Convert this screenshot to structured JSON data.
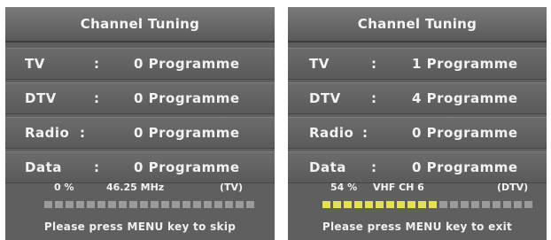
{
  "left": {
    "title": "Channel Tuning",
    "rows": [
      {
        "label": "TV",
        "colon": ":",
        "value": "0 Programme"
      },
      {
        "label": "DTV",
        "colon": ":",
        "value": "0 Programme"
      },
      {
        "label": "Radio",
        "colon": ":",
        "value": "0 Programme"
      },
      {
        "label": "Data",
        "colon": ":",
        "value": "0 Programme"
      }
    ],
    "status": {
      "percent": "0  %",
      "frequency": "46.25 MHz",
      "mode": "(TV)"
    },
    "progress": {
      "segments": 20,
      "filled": 0
    },
    "hint": "Please press MENU key to skip"
  },
  "right": {
    "title": "Channel Tuning",
    "rows": [
      {
        "label": "TV",
        "colon": ":",
        "value": "1 Programme"
      },
      {
        "label": "DTV",
        "colon": ":",
        "value": "4 Programme"
      },
      {
        "label": "Radio",
        "colon": ":",
        "value": "0 Programme"
      },
      {
        "label": "Data",
        "colon": ":",
        "value": "0 Programme"
      }
    ],
    "status": {
      "percent": "54 %",
      "frequency": "VHF  CH  6",
      "mode": "(DTV)"
    },
    "progress": {
      "segments": 20,
      "filled": 11
    },
    "hint": "Please press MENU key to exit"
  },
  "colors": {
    "panel": "#5f5f5f",
    "progress_on": "#e3e34a",
    "progress_off": "#9b9b9b"
  }
}
